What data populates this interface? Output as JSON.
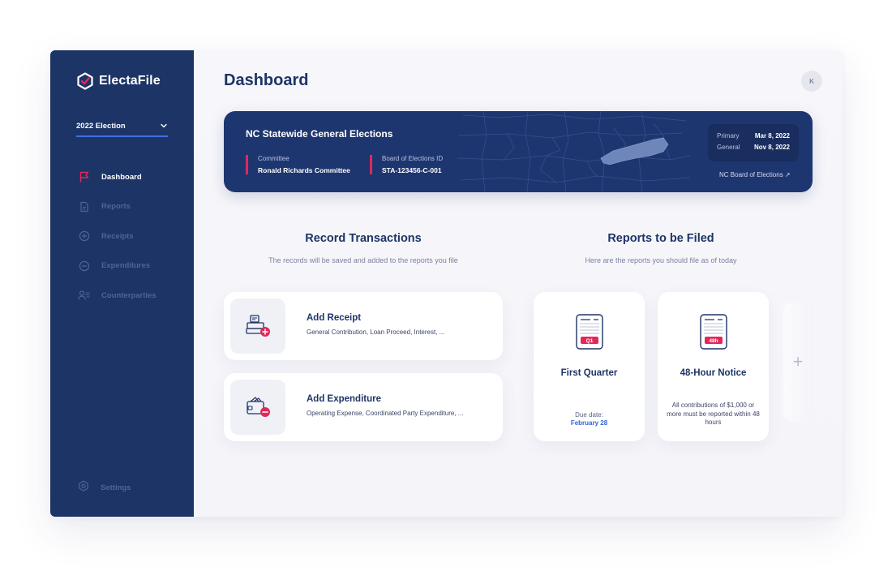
{
  "app": {
    "name": "ElectaFile"
  },
  "sidebar": {
    "election_select": "2022 Election",
    "items": [
      {
        "label": "Dashboard",
        "icon": "flag-icon",
        "active": true
      },
      {
        "label": "Reports",
        "icon": "document-icon",
        "active": false
      },
      {
        "label": "Receipts",
        "icon": "plus-circle-icon",
        "active": false
      },
      {
        "label": "Expenditures",
        "icon": "minus-circle-icon",
        "active": false
      },
      {
        "label": "Counterparties",
        "icon": "people-icon",
        "active": false
      }
    ],
    "settings_label": "Settings"
  },
  "header": {
    "title": "Dashboard",
    "avatar_initial": "K"
  },
  "banner": {
    "title": "NC Statewide General Elections",
    "committee_label": "Committee",
    "committee_value": "Ronald Richards Committee",
    "board_id_label": "Board of Elections ID",
    "board_id_value": "STA-123456-C-001",
    "primary_label": "Primary",
    "primary_date": "Mar 8, 2022",
    "general_label": "General",
    "general_date": "Nov 8, 2022",
    "board_link": "NC Board of Elections ↗"
  },
  "record": {
    "title": "Record Transactions",
    "subtitle": "The records will be saved and added to the reports you file",
    "cards": [
      {
        "title": "Add Receipt",
        "desc": "General Contribution, Loan Proceed, Interest, ..."
      },
      {
        "title": "Add Expenditure",
        "desc": "Operating Expense, Coordinated Party Expenditure, ..."
      }
    ]
  },
  "reports": {
    "title": "Reports to be Filed",
    "subtitle": "Here are the reports you should file as of today",
    "cards": [
      {
        "badge": "Q1",
        "title": "First Quarter",
        "due_label": "Due date:",
        "due_value": "February 28"
      },
      {
        "badge": "48h",
        "title": "48-Hour Notice",
        "note": "All contributions of $1,000 or more must be reported within 48 hours"
      }
    ],
    "add_label": "+"
  },
  "colors": {
    "sidebar": "#1d3466",
    "accent_red": "#e2285a",
    "accent_blue": "#3f6fe6",
    "banner": "#1e3670"
  }
}
